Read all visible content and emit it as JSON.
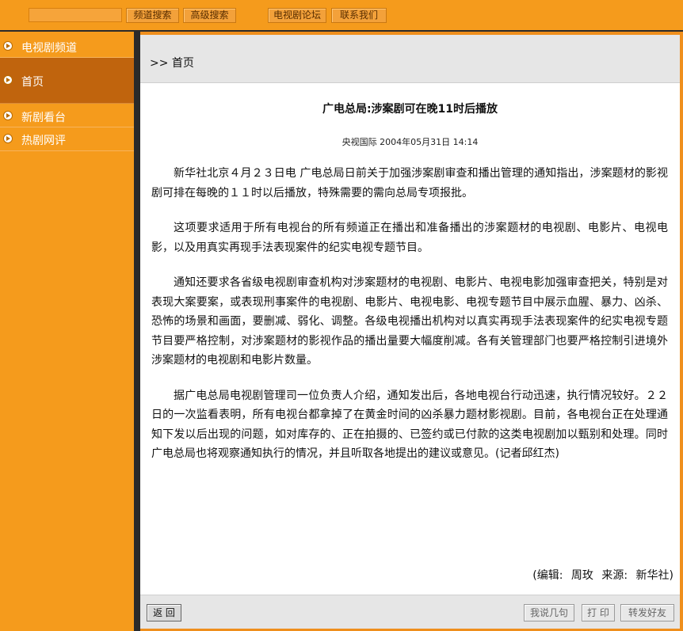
{
  "top_bar": {
    "search_value": "",
    "channel_search_label": "频道搜索",
    "advanced_search_label": "高级搜索",
    "forum_label": "电视剧论坛",
    "contact_label": "联系我们"
  },
  "sidebar": {
    "items": [
      {
        "label": "电视剧频道",
        "selected": false
      },
      {
        "label": "首页",
        "selected": true
      },
      {
        "label": "新剧看台",
        "selected": false
      },
      {
        "label": "热剧网评",
        "selected": false
      }
    ]
  },
  "main": {
    "breadcrumb": ">> 首页",
    "title": "广电总局:涉案剧可在晚11时后播放",
    "meta": "央视国际 2004年05月31日 14:14",
    "paragraphs": [
      "新华社北京４月２３日电 广电总局日前关于加强涉案剧审查和播出管理的通知指出，涉案题材的影视剧可排在每晚的１１时以后播放，特殊需要的需向总局专项报批。",
      "这项要求适用于所有电视台的所有频道正在播出和准备播出的涉案题材的电视剧、电影片、电视电影，以及用真实再现手法表现案件的纪实电视专题节目。",
      "通知还要求各省级电视剧审查机构对涉案题材的电视剧、电影片、电视电影加强审查把关，特别是对表现大案要案，或表现刑事案件的电视剧、电影片、电视电影、电视专题节目中展示血腥、暴力、凶杀、恐怖的场景和画面，要删减、弱化、调整。各级电视播出机构对以真实再现手法表现案件的纪实电视专题节目要严格控制，对涉案题材的影视作品的播出量要大幅度削减。各有关管理部门也要严格控制引进境外涉案题材的电视剧和电影片数量。",
      "据广电总局电视剧管理司一位负责人介绍，通知发出后，各地电视台行动迅速，执行情况较好。２２日的一次监看表明，所有电视台都拿掉了在黄金时间的凶杀暴力题材影视剧。目前，各电视台正在处理通知下发以后出现的问题，如对库存的、正在拍摄的、已签约或已付款的这类电视剧加以甄别和处理。同时广电总局也将观察通知执行的情况，并且听取各地提出的建议或意见。(记者邱红杰)"
    ],
    "footer": "(编辑: 周玫 来源: 新华社)"
  },
  "bottom_bar": {
    "back_label": "返 回",
    "comment_label": "我说几句",
    "print_label": "打 印",
    "share_label": "转发好友"
  },
  "colors": {
    "accent_orange": "#f59b1c",
    "sidebar_selected": "#c0640d",
    "separator": "#2a2a2a"
  }
}
